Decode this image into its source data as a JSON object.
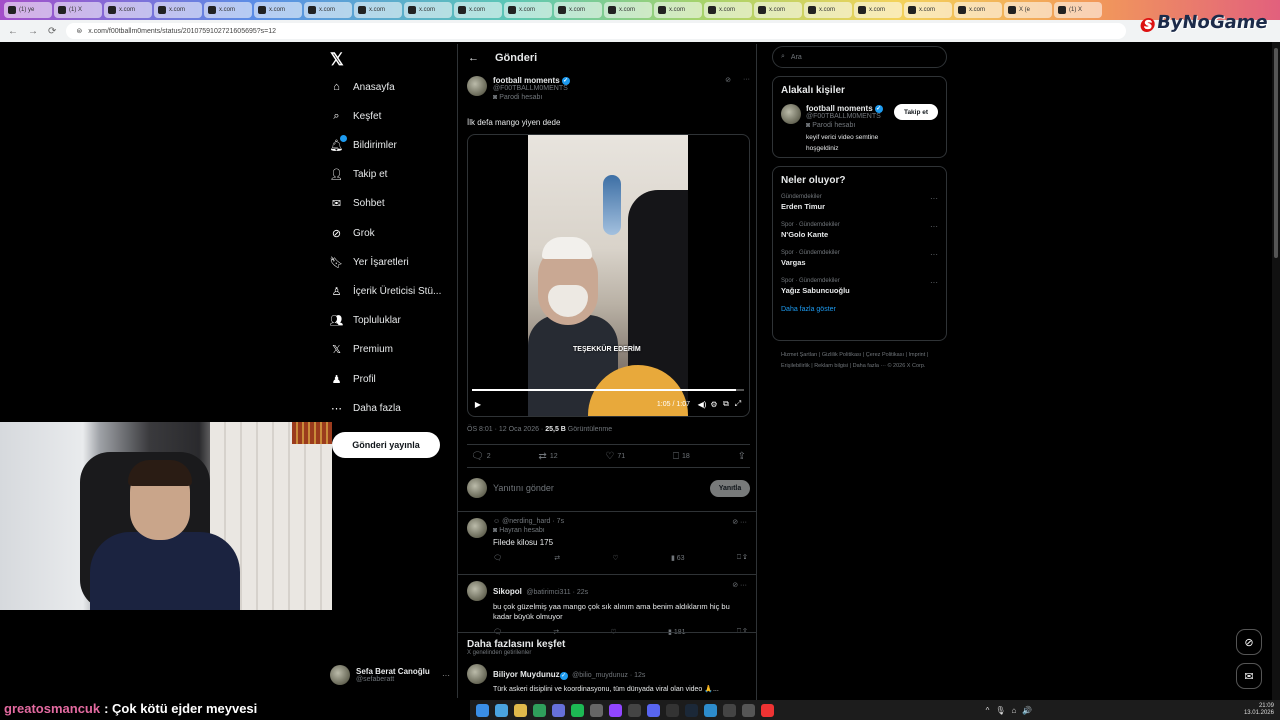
{
  "browser": {
    "tabs": [
      "(1) ye",
      "(1) X",
      "x.com",
      "x.com",
      "x.com",
      "x.com",
      "x.com",
      "x.com",
      "x.com",
      "x.com",
      "x.com",
      "x.com",
      "x.com",
      "x.com",
      "x.com",
      "x.com",
      "x.com",
      "x.com",
      "x.com",
      "x.com",
      "X (e",
      "(1) X"
    ],
    "url": "x.com/f00tballm0ments/status/2010759102721605695?s=12",
    "brand": "ByNoGame"
  },
  "nav": {
    "items": [
      "Anasayfa",
      "Keşfet",
      "Bildirimler",
      "Takip et",
      "Sohbet",
      "Grok",
      "Yer İşaretleri",
      "İçerik Üreticisi Stü...",
      "Topluluklar",
      "Premium",
      "Profil",
      "Daha fazla"
    ],
    "icons": [
      "home-icon",
      "search-icon",
      "bell-icon",
      "follow-icon",
      "mail-icon",
      "grok-icon",
      "bookmark-icon",
      "studio-icon",
      "communities-icon",
      "x-icon",
      "profile-icon",
      "more-icon"
    ],
    "post_button": "Gönderi yayınla",
    "account_name": "Sefa Berat Canoğlu",
    "account_handle": "@sefaberatt"
  },
  "main": {
    "header_title": "Gönderi",
    "author_name": "football moments",
    "author_handle": "@F00TBALLM0MENTS",
    "author_label": "Parodi hesabı",
    "post_text": "İlk defa mango yiyen dede",
    "video_subtitle": "TEŞEKKÜR EDERİM",
    "video_time": "1:05 / 1:07",
    "video_progress": 0.97,
    "meta_time": "ÖS 8:01 · 12 Oca 2026 · ",
    "meta_views_count": "25,5 B",
    "meta_views_label": " Görüntülenme",
    "actions": {
      "replies": "2",
      "reposts": "12",
      "likes": "71",
      "bookmarks": "18"
    },
    "reply_placeholder": "Yanıtını gönder",
    "reply_button": "Yanıtla",
    "replies": [
      {
        "name": "",
        "handle": "@nerding_hard · 7s",
        "label": "Hayran hesabı",
        "text": "Filede kilosu 175",
        "views": "63"
      },
      {
        "name": "Sikopol",
        "handle": "@batirimci311 · 22s",
        "label": "",
        "text": "bu çok güzelmiş yaa mango çok sık alınım ama benim aldıklarım hiç bu kadar büyük olmuyor",
        "views": "181"
      }
    ],
    "explore_title": "Daha fazlasını keşfet",
    "explore_sub": "X genelinden getirilenler",
    "explore_post": {
      "name": "Biliyor Muydunuz",
      "handle": "@bilio_muydunuz · 12s",
      "text": "Türk askeri disiplini ve koordinasyonu, tüm dünyada viral olan video 🙏..."
    }
  },
  "right": {
    "search_placeholder": "Ara",
    "people_title": "Alakalı kişiler",
    "person_name": "football moments",
    "person_handle": "@F00TBALLM0MENTS",
    "person_label": "Parodi hesabı",
    "person_bio": "keyif verici video semtine hoşgeldiniz",
    "follow_button": "Takip et",
    "trends_title": "Neler oluyor?",
    "trends": [
      {
        "ctx": "Gündemdekiler",
        "title": "Erden Timur"
      },
      {
        "ctx": "Spor · Gündemdekiler",
        "title": "N'Golo Kante"
      },
      {
        "ctx": "Spor · Gündemdekiler",
        "title": "Vargas"
      },
      {
        "ctx": "Spor · Gündemdekiler",
        "title": "Yağız Sabuncuoğlu"
      }
    ],
    "show_more": "Daha fazla göster",
    "footer": "Hizmet Şartları  |  Gizlilik Politikası  |  Çerez Politikası  |  Imprint  |  Erişilebilirlik  |  Reklam bilgisi  |  Daha fazla ···  © 2026 X Corp."
  },
  "chat": {
    "user": "greatosmancuk",
    "message": ": Çok kötü ejder meyvesi"
  },
  "taskbar": {
    "time": "21:09",
    "date": "13.01.2026"
  },
  "colors": {
    "accent": "#1d9bf0",
    "background": "#000000",
    "border": "#2f3336"
  }
}
